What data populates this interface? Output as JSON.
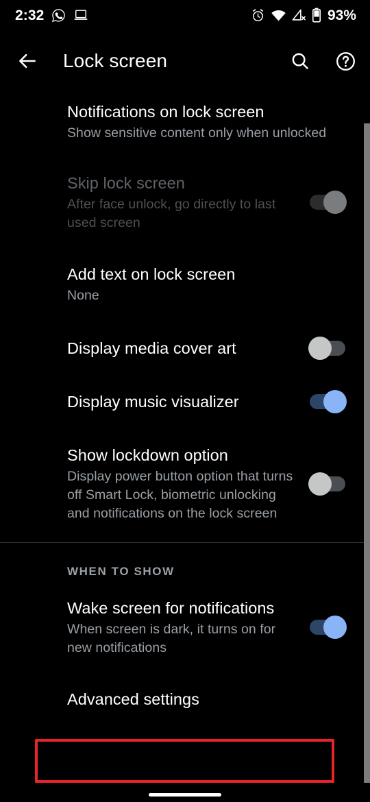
{
  "status_bar": {
    "time": "2:32",
    "battery_percent": "93%",
    "left_icons": [
      "whatsapp-icon",
      "laptop-icon"
    ],
    "right_icons": [
      "alarm-icon",
      "wifi-icon",
      "mobile-data-off-icon",
      "battery-icon"
    ]
  },
  "app_bar": {
    "back_label": "back-arrow",
    "title": "Lock screen",
    "search_label": "search-icon",
    "help_label": "help-icon"
  },
  "settings": [
    {
      "title": "Notifications on lock screen",
      "summary": "Show sensitive content only when unlocked",
      "has_switch": false,
      "switch_state": "",
      "disabled": false
    },
    {
      "title": "Skip lock screen",
      "summary": "After face unlock, go directly to last used screen",
      "has_switch": true,
      "switch_state": "on-disabled",
      "disabled": true
    },
    {
      "title": "Add text on lock screen",
      "summary": "None",
      "has_switch": false,
      "switch_state": "",
      "disabled": false
    },
    {
      "title": "Display media cover art",
      "summary": "",
      "has_switch": true,
      "switch_state": "off",
      "disabled": false
    },
    {
      "title": "Display music visualizer",
      "summary": "",
      "has_switch": true,
      "switch_state": "on",
      "disabled": false
    },
    {
      "title": "Show lockdown option",
      "summary": "Display power button option that turns off Smart Lock, biometric unlocking and notifications on the lock screen",
      "has_switch": true,
      "switch_state": "off",
      "disabled": false
    }
  ],
  "section": {
    "label": "WHEN TO SHOW",
    "items": [
      {
        "title": "Wake screen for notifications",
        "summary": "When screen is dark, it turns on for new notifications",
        "has_switch": true,
        "switch_state": "on",
        "disabled": false
      },
      {
        "title": "Advanced settings",
        "summary": "",
        "has_switch": false,
        "switch_state": "",
        "disabled": false
      }
    ]
  },
  "highlight": {
    "target": "Advanced settings",
    "color": "#e8242a"
  },
  "colors": {
    "background": "#000000",
    "primary_text": "#ffffff",
    "secondary_text": "#9aa0a6",
    "disabled_text": "#5f6368",
    "accent_on": "#8ab4f8",
    "switch_off_thumb": "#c4c7c5",
    "switch_off_track": "#4a4d51",
    "divider": "#303134",
    "scrollbar": "#7c7c7c",
    "highlight": "#e8242a"
  }
}
